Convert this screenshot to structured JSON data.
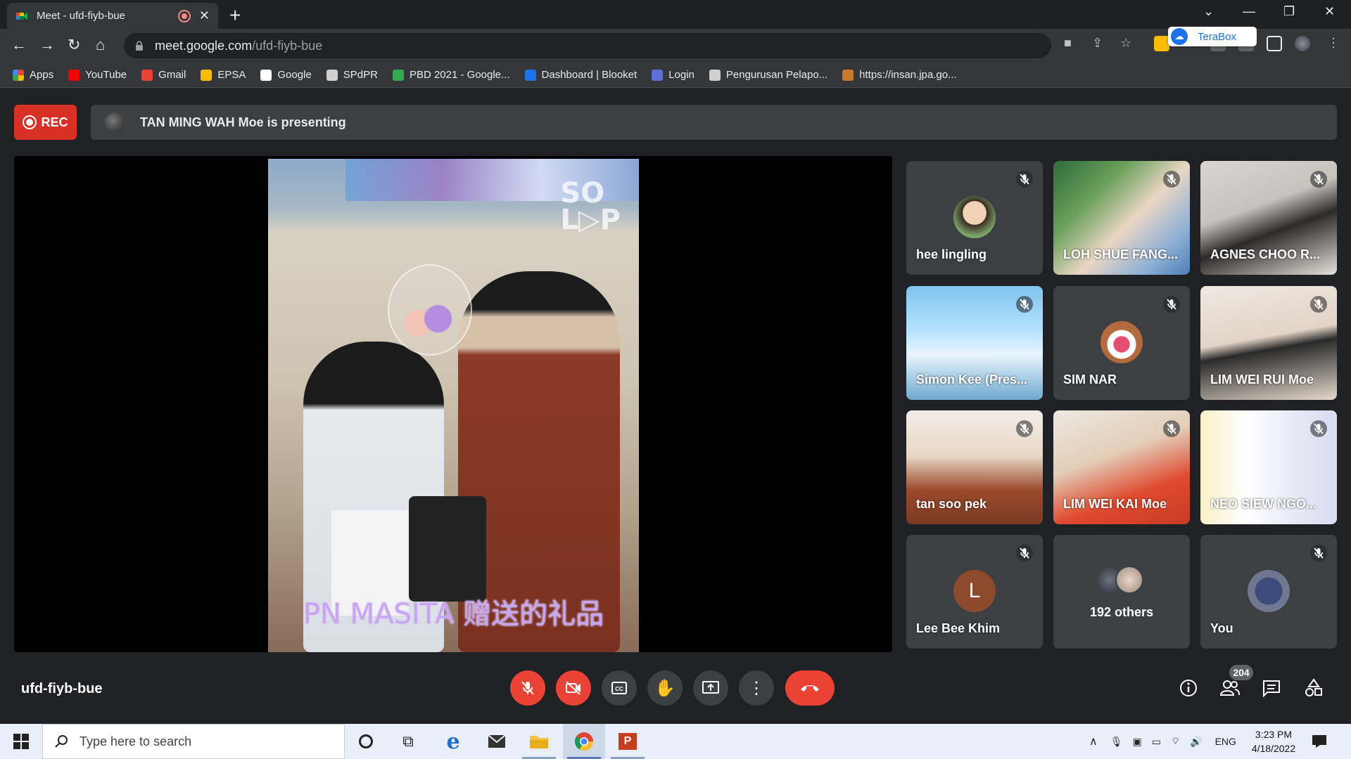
{
  "browser": {
    "tab_title": "Meet - ufd-fiyb-bue",
    "url_host": "meet.google.com",
    "url_path": "/ufd-fiyb-bue",
    "extension_popup": "TeraBox"
  },
  "bookmarks": [
    {
      "label": "Apps",
      "color": "#4285f4"
    },
    {
      "label": "YouTube",
      "color": "#ff0000"
    },
    {
      "label": "Gmail",
      "color": "#ea4335"
    },
    {
      "label": "EPSA",
      "color": "#fbbc05"
    },
    {
      "label": "Google",
      "color": "#ffffff"
    },
    {
      "label": "SPdPR",
      "color": "#d0d0d0"
    },
    {
      "label": "PBD 2021 - Google...",
      "color": "#34a853"
    },
    {
      "label": "Dashboard | Blooket",
      "color": "#1a73e8"
    },
    {
      "label": "Login",
      "color": "#5b6fd6"
    },
    {
      "label": "Pengurusan Pelapo...",
      "color": "#d0d0d0"
    },
    {
      "label": "https://insan.jpa.go...",
      "color": "#c77b2a"
    }
  ],
  "meet": {
    "rec_label": "REC",
    "presenting_text": "TAN MING WAH Moe is presenting",
    "stage_caption": "PN MASITA 赠送的礼品",
    "stage_logo": "SO LOP",
    "meeting_code": "ufd-fiyb-bue",
    "participant_count": "204",
    "participants": [
      {
        "name": "hee lingling",
        "type": "avatar"
      },
      {
        "name": "LOH SHUE FANG...",
        "type": "video"
      },
      {
        "name": "AGNES CHOO R...",
        "type": "video"
      },
      {
        "name": "Simon Kee (Pres...",
        "type": "video"
      },
      {
        "name": "SIM NAR",
        "type": "avatar"
      },
      {
        "name": "LIM WEI RUI Moe",
        "type": "video"
      },
      {
        "name": "tan soo pek",
        "type": "video"
      },
      {
        "name": "LIM WEI KAI Moe",
        "type": "video"
      },
      {
        "name": "NEO SIEW NGO...",
        "type": "video"
      },
      {
        "name": "Lee Bee Khim",
        "type": "letter",
        "letter": "L",
        "color": "#8d4a2d"
      },
      {
        "name": "192 others",
        "type": "others"
      },
      {
        "name": "You",
        "type": "avatar"
      }
    ],
    "colors": {
      "danger": "#ea4335",
      "surface": "#3c4043",
      "background": "#202124"
    }
  },
  "taskbar": {
    "search_placeholder": "Type here to search",
    "language": "ENG",
    "time": "3:23 PM",
    "date": "4/18/2022"
  }
}
